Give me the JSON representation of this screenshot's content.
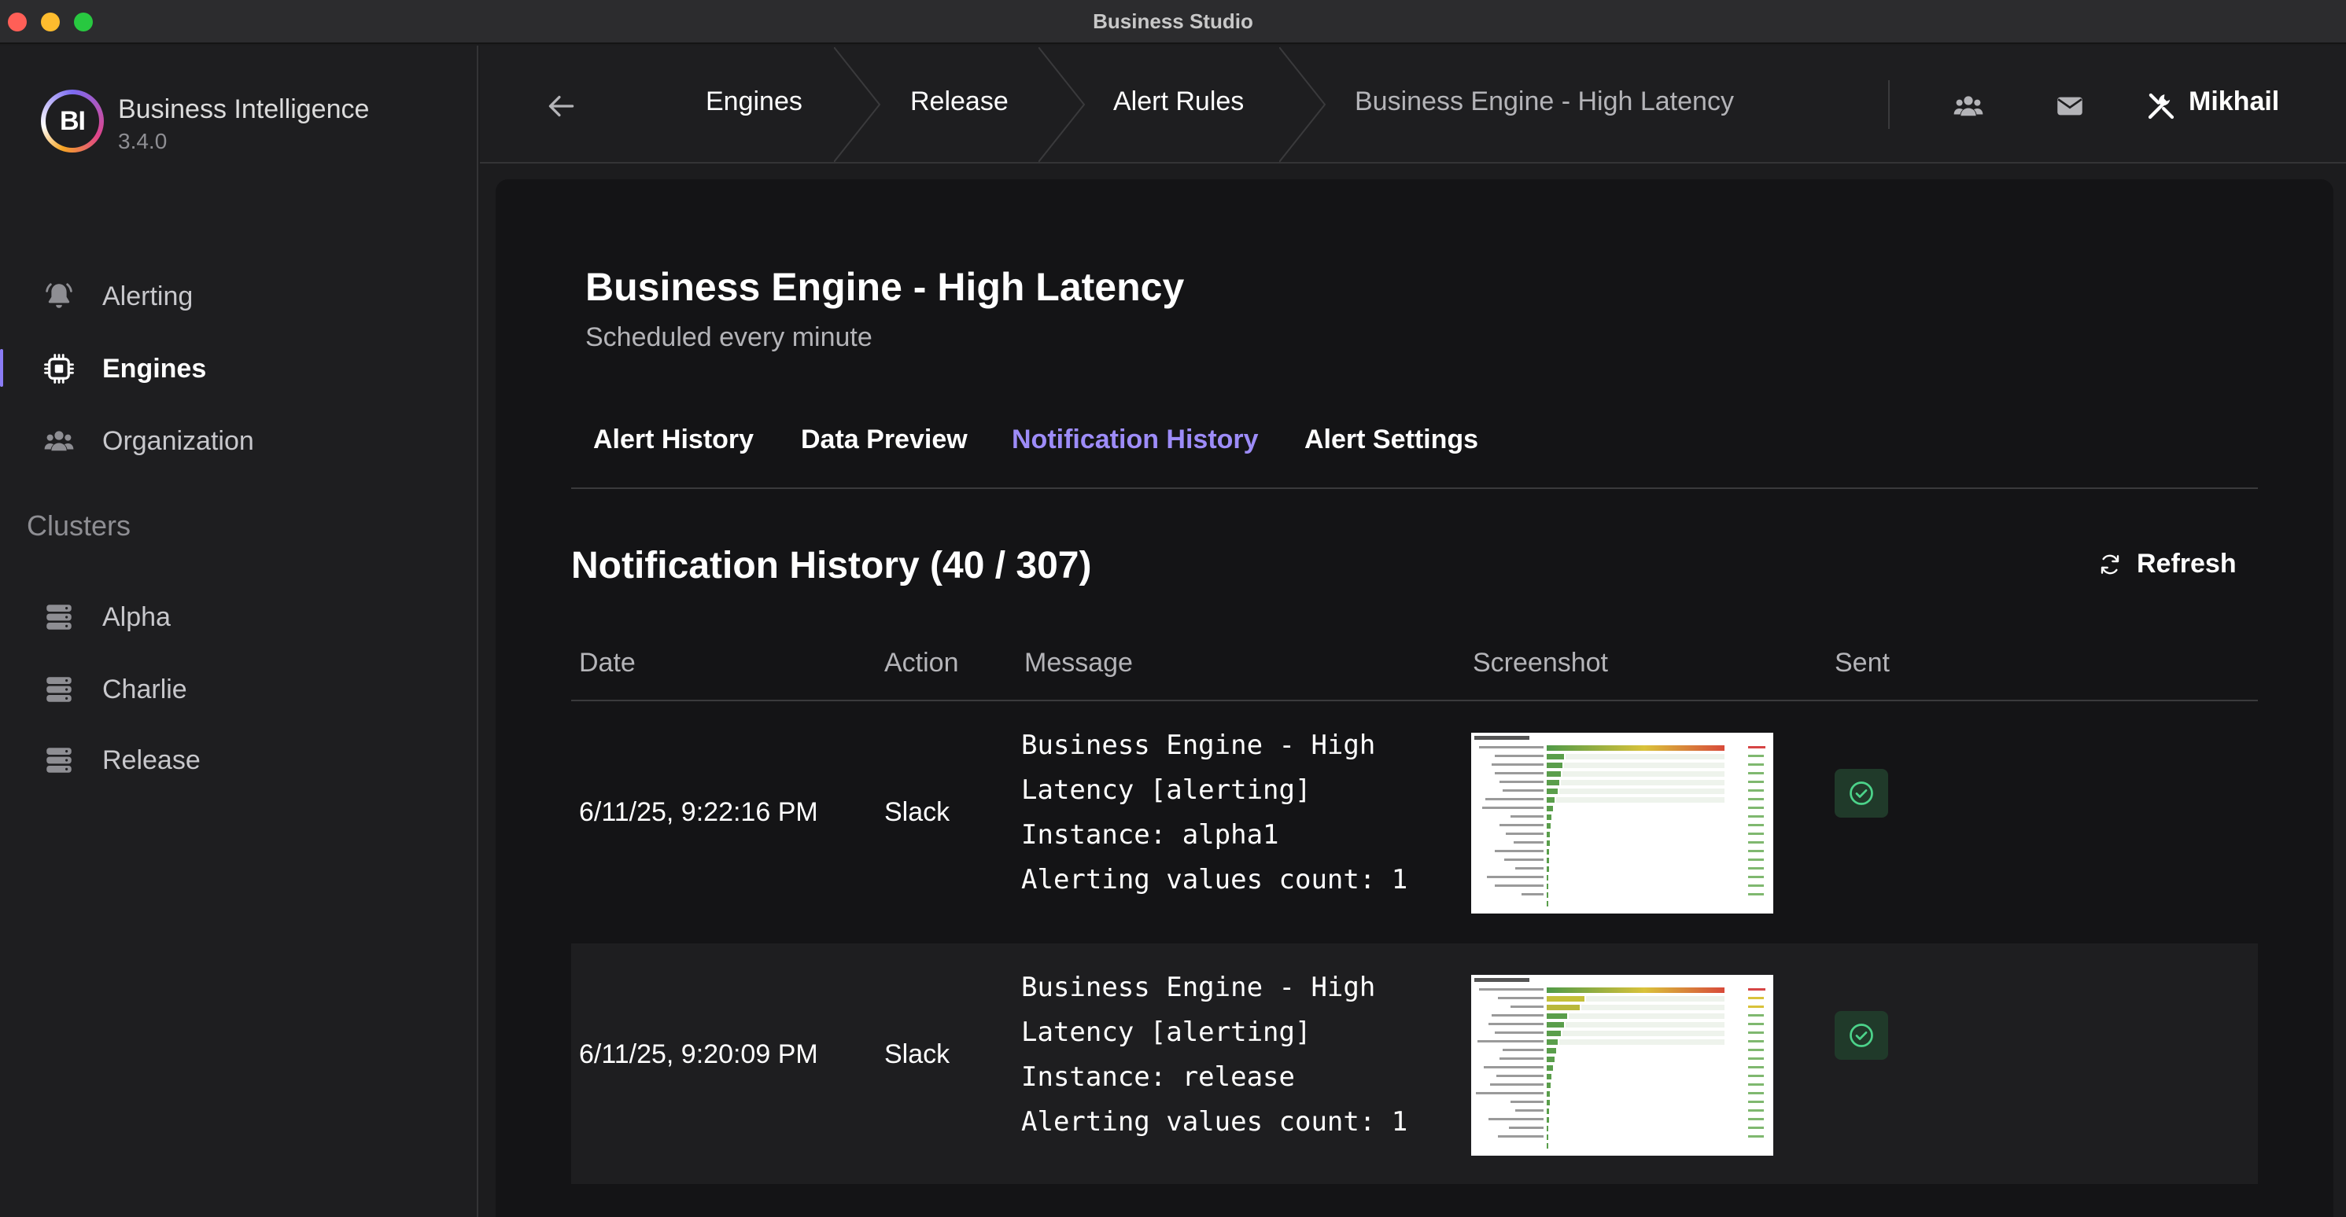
{
  "window": {
    "title": "Business Studio"
  },
  "brand": {
    "logo_text": "BI",
    "name": "Business Intelligence",
    "version": "3.4.0"
  },
  "sidebar": {
    "items": [
      {
        "label": "Alerting",
        "icon": "bell-icon"
      },
      {
        "label": "Engines",
        "icon": "cpu-chip-icon",
        "active": true
      },
      {
        "label": "Organization",
        "icon": "users-icon"
      }
    ],
    "clusters_title": "Clusters",
    "clusters": [
      {
        "label": "Alpha",
        "icon": "server-stack-icon"
      },
      {
        "label": "Charlie",
        "icon": "server-stack-icon"
      },
      {
        "label": "Release",
        "icon": "server-stack-icon"
      }
    ]
  },
  "header": {
    "breadcrumbs": [
      "Engines",
      "Release",
      "Alert Rules",
      "Business Engine - High Latency"
    ],
    "user": "Mikhail"
  },
  "page": {
    "title": "Business Engine - High Latency",
    "subtitle": "Scheduled every minute",
    "tabs": [
      {
        "label": "Alert History"
      },
      {
        "label": "Data Preview"
      },
      {
        "label": "Notification History",
        "active": true
      },
      {
        "label": "Alert Settings"
      }
    ],
    "section_title": "Notification History (40 / 307)",
    "refresh_label": "Refresh"
  },
  "table": {
    "columns": [
      "Date",
      "Action",
      "Message",
      "Screenshot",
      "Sent"
    ],
    "rows": [
      {
        "date": "6/11/25, 9:22:16 PM",
        "action": "Slack",
        "message": [
          "Business Engine - High",
          "Latency [alerting]",
          "Instance: alpha1",
          "Alerting values count: 1"
        ],
        "sent": true
      },
      {
        "date": "6/11/25, 9:20:09 PM",
        "action": "Slack",
        "message": [
          "Business Engine - High",
          "Latency [alerting]",
          "Instance: release",
          "Alerting values count: 1"
        ],
        "sent": true
      }
    ]
  },
  "colors": {
    "accent": "#9d8cf8",
    "background": "#141416",
    "sidebar": "#1e1e20",
    "success": "#4cd38a"
  }
}
